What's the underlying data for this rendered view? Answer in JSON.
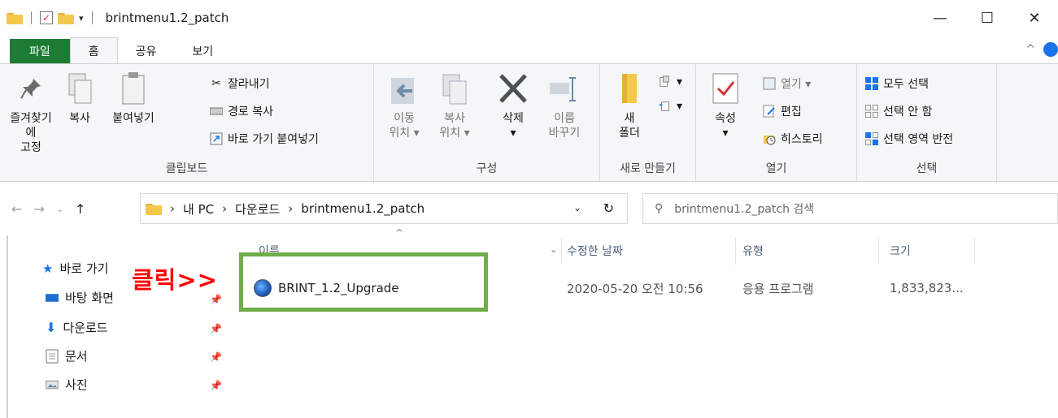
{
  "window": {
    "title": "brintmenu1.2_patch",
    "minimize": "—",
    "maximize": "☐",
    "close": "✕"
  },
  "tabs": [
    {
      "label": "파일"
    },
    {
      "label": "홈"
    },
    {
      "label": "공유"
    },
    {
      "label": "보기"
    }
  ],
  "tab_right_chevron": "^",
  "ribbon": {
    "clipboard": {
      "label": "클립보드",
      "pin_line1": "즐겨찾기에",
      "pin_line2": "고정",
      "copy": "복사",
      "paste": "붙여넣기",
      "cut": "잘라내기",
      "copy_path": "경로 복사",
      "paste_shortcut": "바로 가기 붙여넣기"
    },
    "organize": {
      "label": "구성",
      "move_line1": "이동",
      "move_line2": "위치 ▾",
      "copyto_line1": "복사",
      "copyto_line2": "위치 ▾",
      "delete": "삭제",
      "delete_arrow": "▾",
      "rename_line1": "이름",
      "rename_line2": "바꾸기"
    },
    "new": {
      "label": "새로 만들기",
      "folder_line1": "새",
      "folder_line2": "폴더"
    },
    "open": {
      "label": "열기",
      "properties": "속성",
      "properties_arrow": "▾",
      "open": "열기 ▾",
      "edit": "편집",
      "history": "히스토리"
    },
    "select": {
      "label": "선택",
      "select_all": "모두 선택",
      "select_none": "선택 안 함",
      "invert": "선택 영역 반전"
    }
  },
  "address": {
    "crumbs": [
      "내 PC",
      "다운로드",
      "brintmenu1.2_patch"
    ],
    "search_placeholder": "brintmenu1.2_patch 검색"
  },
  "sidebar": {
    "quick_access": "바로 가기",
    "items": [
      {
        "label": "바탕 화면"
      },
      {
        "label": "다운로드"
      },
      {
        "label": "문서"
      },
      {
        "label": "사진"
      }
    ]
  },
  "columns": {
    "name": "이름",
    "modified": "수정한 날짜",
    "type": "유형",
    "size": "크기"
  },
  "files": [
    {
      "name": "BRINT_1.2_Upgrade",
      "modified": "2020-05-20 오전 10:56",
      "type": "응용 프로그램",
      "size": "1,833,823..."
    }
  ],
  "annotation": {
    "text": "클릭>>",
    "box_color": "#70ad47",
    "text_color": "#ff0000"
  },
  "colors": {
    "file_tab": "#1e7b34",
    "ribbon_bg": "#f5f6f7",
    "accent": "#1a73e8"
  }
}
